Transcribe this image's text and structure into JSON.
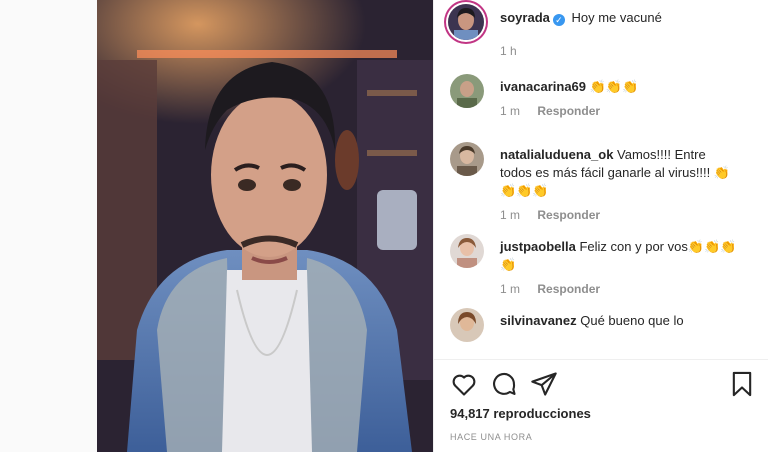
{
  "post": {
    "username": "soyrada",
    "caption": "Hoy me vacuné",
    "time": "1 h"
  },
  "comments": [
    {
      "username": "ivanacarina69",
      "text": "",
      "emoji": "👏👏👏",
      "time": "1 m",
      "reply": "Responder"
    },
    {
      "username": "natalialuduena_ok",
      "text": "Vamos!!!! Entre todos es más fácil ganarle al virus!!!!",
      "emoji": "👏👏👏👏",
      "time": "1 m",
      "reply": "Responder"
    },
    {
      "username": "justpaobella",
      "text": "Feliz con y por vos",
      "emoji": "👏👏👏👏",
      "time": "1 m",
      "reply": "Responder"
    },
    {
      "username": "silvinavanez",
      "text": "Qué bueno que lo",
      "emoji": "",
      "time": "",
      "reply": ""
    }
  ],
  "footer": {
    "views": "94,817 reproducciones",
    "ago": "HACE UNA HORA"
  },
  "icons": [
    "heart-icon",
    "comment-icon",
    "share-icon",
    "bookmark-icon",
    "verified-icon"
  ],
  "colors": {
    "verified": "#3897f0",
    "story_ring": "#c13584",
    "muted": "#8e8e8e"
  }
}
